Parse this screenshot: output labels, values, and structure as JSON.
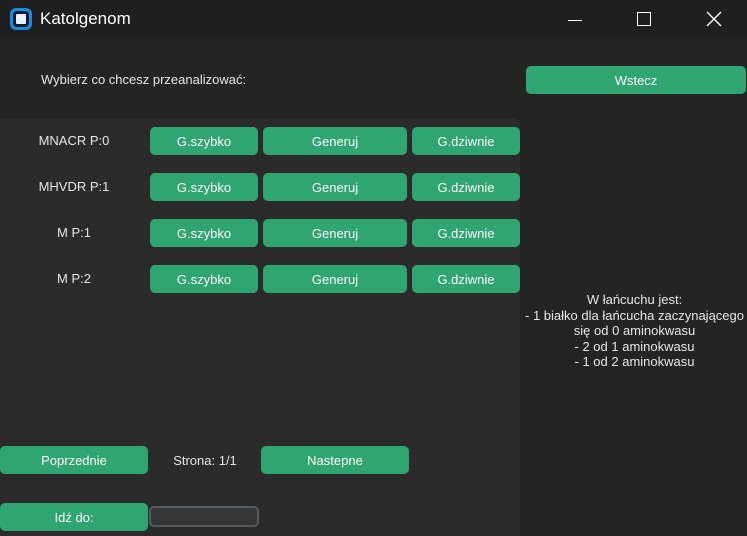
{
  "window": {
    "title": "Katolgenom"
  },
  "header": {
    "prompt": "Wybierz co chcesz przeanalizować:",
    "back_label": "Wstecz"
  },
  "rows": [
    {
      "label": "MNACR P:0",
      "fast": "G.szybko",
      "generate": "Generuj",
      "weird": "G.dziwnie"
    },
    {
      "label": "MHVDR P:1",
      "fast": "G.szybko",
      "generate": "Generuj",
      "weird": "G.dziwnie"
    },
    {
      "label": "M P:1",
      "fast": "G.szybko",
      "generate": "Generuj",
      "weird": "G.dziwnie"
    },
    {
      "label": "M P:2",
      "fast": "G.szybko",
      "generate": "Generuj",
      "weird": "G.dziwnie"
    }
  ],
  "pagination": {
    "prev_label": "Poprzednie",
    "page_text": "Strona: 1/1",
    "next_label": "Nastepne"
  },
  "goto": {
    "label": "Idź do:",
    "value": ""
  },
  "info": {
    "lines": [
      "W łańcuchu jest:",
      "- 1 białko dla łańcucha zaczynającego",
      "się od 0 aminokwasu",
      "- 2 od 1 aminokwasu",
      "- 1 od 2 aminokwasu"
    ]
  },
  "colors": {
    "accent": "#2fa572",
    "background": "#242424",
    "panel": "#2b2b2b"
  }
}
